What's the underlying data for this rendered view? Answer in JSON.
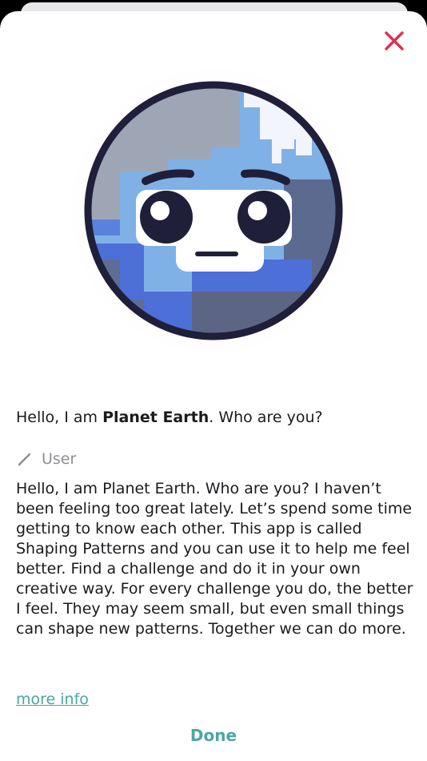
{
  "dialog": {
    "greeting_prefix": "Hello, I am ",
    "greeting_name": "Planet Earth",
    "greeting_suffix": ". Who are you?",
    "speaker_label": "User",
    "message": "Hello, I am Planet Earth. Who are you? I haven’t been feeling too great lately. Let’s spend some time getting to know each other. This app is called Shaping Patterns and you can use it to help me feel better. Find a challenge and do it in your own creative way. For every challenge you do, the better I feel. They may seem small, but even small things can shape new patterns. Together we can do more.",
    "more_info_label": "more info",
    "done_label": "Done"
  },
  "icons": {
    "close": "close-icon",
    "pencil": "pencil-icon",
    "earth": "planet-earth-character"
  },
  "colors": {
    "close": "#e0304e",
    "accent": "#4aa7a3",
    "ocean_blue": "#5b7fe0",
    "land_gray": "#9aa3b8",
    "outline": "#1f1f3a"
  }
}
